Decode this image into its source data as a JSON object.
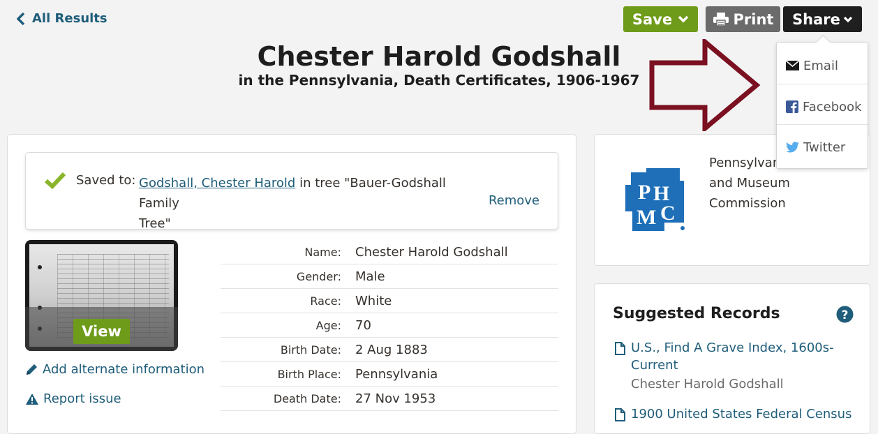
{
  "nav": {
    "back_label": "All Results"
  },
  "toolbar": {
    "save_label": "Save",
    "print_label": "Print",
    "share_label": "Share"
  },
  "header": {
    "title": "Chester Harold Godshall",
    "subtitle": "in the Pennsylvania, Death Certificates, 1906-1967"
  },
  "share_menu": {
    "items": [
      {
        "label": "Email",
        "icon": "envelope-icon"
      },
      {
        "label": "Facebook",
        "icon": "facebook-icon"
      },
      {
        "label": "Twitter",
        "icon": "twitter-icon"
      }
    ]
  },
  "saved": {
    "label": "Saved to:",
    "person_link": "Godshall, Chester Harold",
    "tree_text_line1": " in tree \"Bauer-Godshall Family",
    "tree_text_line2": "Tree\"",
    "remove_label": "Remove"
  },
  "image": {
    "view_label": "View"
  },
  "actions": {
    "add_alternate": "Add alternate information",
    "report_issue": "Report issue"
  },
  "facts": [
    {
      "label": "Name:",
      "value": "Chester Harold Godshall"
    },
    {
      "label": "Gender:",
      "value": "Male"
    },
    {
      "label": "Race:",
      "value": "White"
    },
    {
      "label": "Age:",
      "value": "70"
    },
    {
      "label": "Birth Date:",
      "value": "2 Aug 1883"
    },
    {
      "label": "Birth Place:",
      "value": "Pennsylvania"
    },
    {
      "label": "Death Date:",
      "value": "27 Nov 1953"
    }
  ],
  "source": {
    "logo_text": "PHMC",
    "line1": "Pennsylvan",
    "line2": "and Museum",
    "line3": "Commission"
  },
  "suggested": {
    "title": "Suggested Records",
    "records": [
      {
        "line1": "U.S., Find A Grave Index, 1600s-",
        "line2": "Current",
        "sub": "Chester Harold Godshall"
      },
      {
        "line1": "1900 United States Federal Census"
      }
    ]
  },
  "colors": {
    "link": "#1f5d7a",
    "save_green": "#6f9b1a",
    "print_gray": "#6b6b6b",
    "share_black": "#1f1f1f",
    "arrow_red": "#7a1020",
    "logo_blue": "#1e6fb8"
  }
}
